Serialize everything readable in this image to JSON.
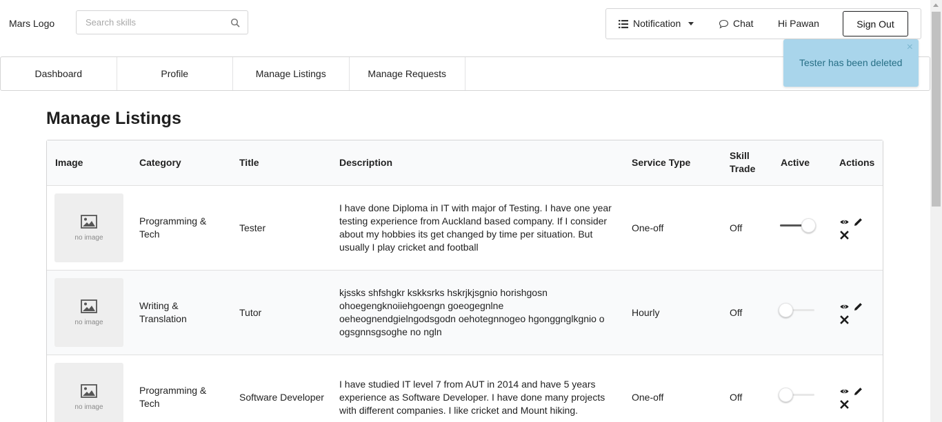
{
  "header": {
    "logo": "Mars Logo",
    "search_placeholder": "Search skills",
    "notification_label": "Notification",
    "chat_label": "Chat",
    "greeting": "Hi Pawan",
    "signout_label": "Sign Out"
  },
  "tabs": [
    {
      "label": "Dashboard"
    },
    {
      "label": "Profile"
    },
    {
      "label": "Manage Listings"
    },
    {
      "label": "Manage Requests"
    }
  ],
  "toast": {
    "message": "Tester has been deleted",
    "close": "×"
  },
  "page_title": "Manage Listings",
  "table": {
    "headers": {
      "image": "Image",
      "category": "Category",
      "title": "Title",
      "description": "Description",
      "service_type": "Service Type",
      "skill_trade_1": "Skill",
      "skill_trade_2": "Trade",
      "active": "Active",
      "actions": "Actions"
    },
    "no_image_text": "no image",
    "rows": [
      {
        "category": "Programming & Tech",
        "title": "Tester",
        "description": "I have done Diploma in IT with major of Testing. I have one year testing experience from Auckland based company. If I consider about my hobbies its get changed by time per situation. But usually I play cricket and football",
        "service_type": "One-off",
        "skill_trade": "Off",
        "active": 1
      },
      {
        "category": "Writing & Translation",
        "title": "Tutor",
        "description": "kjssks shfshgkr kskksrks hskrjkjsgnio horishgosn ohoegengknoiiehgoengn goeogegnlne oeheognendgielngodsgodn oehotegnnogeo hgonggnglkgnio o ogsgnnsgsoghe no ngln",
        "service_type": "Hourly",
        "skill_trade": "Off",
        "active": 0
      },
      {
        "category": "Programming & Tech",
        "title": "Software Developer",
        "description": "I have studied IT level 7 from AUT in 2014 and have 5 years experience as Software Developer. I have done many projects with different companies. I like cricket and Mount hiking.",
        "service_type": "One-off",
        "skill_trade": "Off",
        "active": 0
      }
    ]
  }
}
